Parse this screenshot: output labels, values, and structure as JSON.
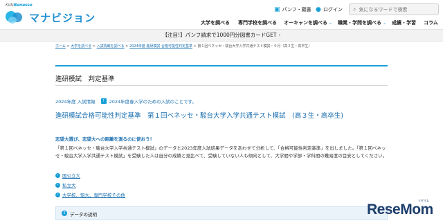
{
  "header": {
    "benesse_prefix": "Kids",
    "benesse_name": "Benesse",
    "logo_text": "マナビジョン",
    "utility": {
      "pamphlet_label": "パンフ・願書",
      "login_label": "ログイン"
    },
    "search_placeholder": "気になるワードで検索",
    "nav": [
      "大学を調べる",
      "専門学校を調べる",
      "オーキャンを調べる",
      "職業・学問を調べる",
      "成績・学習",
      "コラム"
    ]
  },
  "banner": {
    "text": "【注目!】パンフ請求で1000円分図書カードGET",
    "arrow": "›"
  },
  "breadcrumb": {
    "items": [
      "ホーム",
      "大学を調べる",
      "入試情報を調べる",
      "2024年度 進研模試 合格可能性判定基準",
      "第１回ベネッセ・駿台大学入学共通テスト模試・９月（高３生・高卒生）"
    ],
    "separator": ">"
  },
  "page_title": "進研模試　判定基準",
  "year_line": {
    "label": "2024年度 入試情報",
    "badge": "!",
    "note": "2024年度春入学のための入試のことです。"
  },
  "subtitle": "進研模試合格可能性判定基準　第１回ベネッセ・駿台大学入学共通テスト模試　(高３生・高卒生)",
  "lead": "志望大選び、志望大への距離を測るのに使おう！",
  "body_text": "「第１回ベネッセ・駿台大学入学共通テスト模試」のデータと2023年度入試結果データをあわせて分析して、「合格可能性判定基準」を出しました。「第１回ベネッセ・駿台大学入学共通テスト模試」を受験した人は自分の成績と見比べて、受験していない人も傾向として、大学間や学部・学科間の難易度の目安としてください。",
  "links": [
    "国公立大",
    "私立大",
    "大学校、短大、専門学校その他"
  ],
  "data_box_label": "データの説明",
  "watermark": {
    "text": "ReseMom",
    "sub": "リセマム"
  }
}
